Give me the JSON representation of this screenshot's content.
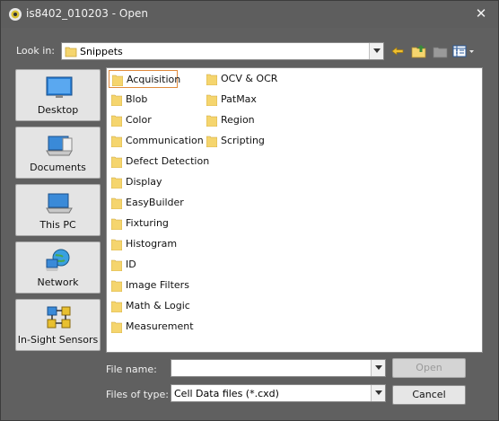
{
  "window": {
    "title": "is8402_010203 - Open",
    "close_glyph": "✕"
  },
  "lookin": {
    "label": "Look in:",
    "value": "Snippets"
  },
  "toolbar": [
    "back-icon",
    "up-folder-icon",
    "new-folder-icon",
    "views-menu-icon"
  ],
  "places": [
    {
      "label": "Desktop",
      "icon": "desktop-icon"
    },
    {
      "label": "Documents",
      "icon": "documents-icon"
    },
    {
      "label": "This PC",
      "icon": "this-pc-icon"
    },
    {
      "label": "Network",
      "icon": "network-icon"
    },
    {
      "label": "In-Sight Sensors",
      "icon": "in-sight-sensors-icon"
    }
  ],
  "files": {
    "column1": [
      "Acquisition",
      "Blob",
      "Color",
      "Communication",
      "Defect Detection",
      "Display",
      "EasyBuilder",
      "Fixturing",
      "Histogram",
      "ID",
      "Image Filters",
      "Math & Logic",
      "Measurement"
    ],
    "column2": [
      "OCV & OCR",
      "PatMax",
      "Region",
      "Scripting"
    ],
    "selected": "Acquisition"
  },
  "filename": {
    "label": "File name:",
    "value": ""
  },
  "filetype": {
    "label": "Files of type:",
    "value": "Cell Data files (*.cxd)"
  },
  "buttons": {
    "open": "Open",
    "cancel": "Cancel"
  },
  "colors": {
    "folder": "#f5d56e",
    "selection_border": "#e08a3c",
    "background": "#606060"
  }
}
